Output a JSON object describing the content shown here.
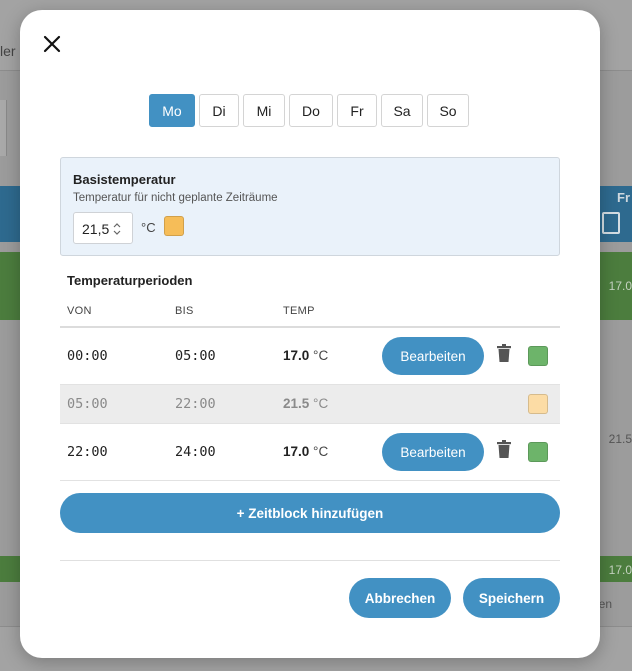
{
  "background": {
    "top_fragment": "ler",
    "right_header_fragment": "Fr",
    "right_value_top": "17.0",
    "right_value_mid": "21.5",
    "right_value_bottom": "17.0",
    "footer_fragment": "en"
  },
  "modal": {
    "close_icon": "close-icon",
    "days": [
      {
        "label": "Mo",
        "active": true
      },
      {
        "label": "Di",
        "active": false
      },
      {
        "label": "Mi",
        "active": false
      },
      {
        "label": "Do",
        "active": false
      },
      {
        "label": "Fr",
        "active": false
      },
      {
        "label": "Sa",
        "active": false
      },
      {
        "label": "So",
        "active": false
      }
    ],
    "base": {
      "title": "Basistemperatur",
      "subtitle": "Temperatur für nicht geplante Zeiträume",
      "value": "21,5",
      "unit": "°C",
      "color": "#f6bd58"
    },
    "periods": {
      "title": "Temperaturperioden",
      "columns": {
        "from": "VON",
        "to": "BIS",
        "temp": "TEMP"
      },
      "rows": [
        {
          "from": "00:00",
          "to": "05:00",
          "temp": "17.0",
          "unit": "°C",
          "edit_label": "Bearbeiten",
          "color": "#6db46a",
          "editable": true
        },
        {
          "from": "05:00",
          "to": "22:00",
          "temp": "21.5",
          "unit": "°C",
          "edit_label": "",
          "color": "#fcdca5",
          "editable": false
        },
        {
          "from": "22:00",
          "to": "24:00",
          "temp": "17.0",
          "unit": "°C",
          "edit_label": "Bearbeiten",
          "color": "#6db46a",
          "editable": true
        }
      ]
    },
    "add_button": "+ Zeitblock hinzufügen",
    "cancel_button": "Abbrechen",
    "save_button": "Speichern",
    "accent_color": "#4291c3"
  }
}
